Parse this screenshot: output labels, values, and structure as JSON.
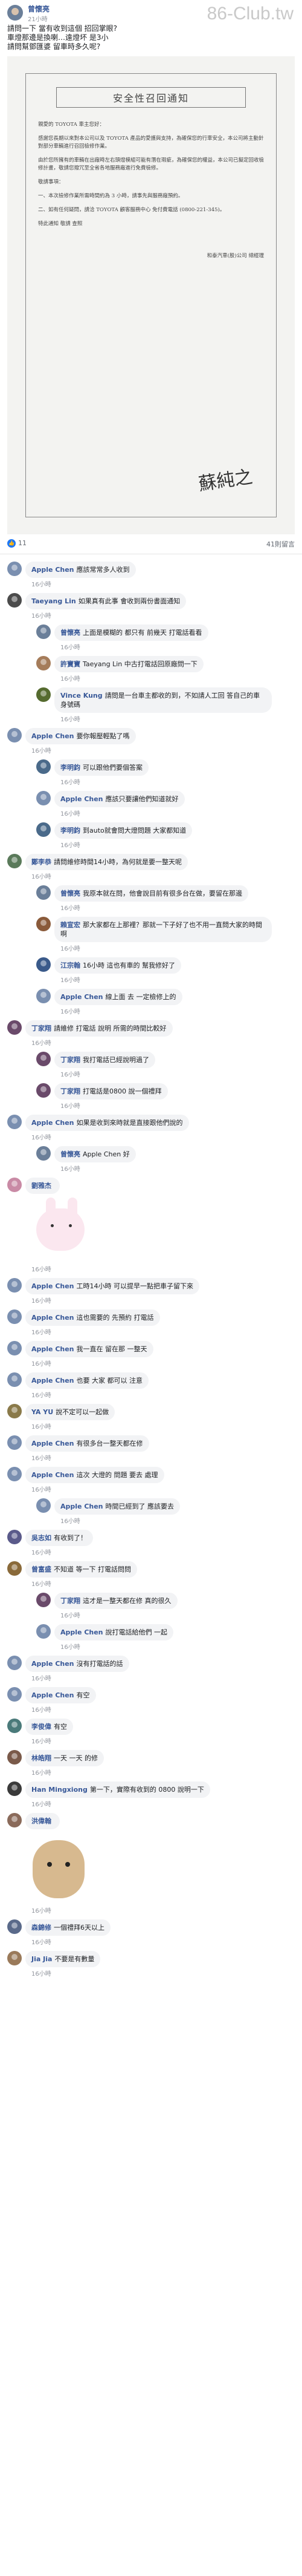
{
  "watermark": "86-Club.tw",
  "post": {
    "author": "曾懷亮",
    "time": "21小時",
    "text": [
      "請問一下 當有收到這個 招回掌眼?",
      "車燈那邊是換喇…遠燈坏 是3小",
      "請問幫鄧匯婆 留車時多久呢?"
    ]
  },
  "letter": {
    "title": "安全性召回通知",
    "p1": "親愛的 TOYOTA 車主您好：",
    "p2": "感謝您長期以來對本公司以及 TOYOTA 產品的愛護與支持，為確保您的行車安全，本公司將主動針對部分車輛進行召回檢修作業。",
    "p3": "由於您所擁有的車輛在出廠時左右頭燈模組可能有潛在瑕疵，為確保您的權益，本公司已擬定回收檢修計畫，敬請您撥冗至全省各地服務廠進行免費檢修。",
    "p4": "敬請事項：",
    "p5": "一、本次檢修作業所需時間約為 3 小時，請事先與服務廠預約。",
    "p6": "二、如有任何疑問，請洽 TOYOTA 顧客服務中心 免付費電話 (0800-221-345)。",
    "p7": "特此通知 敬請 查照",
    "p8": "和泰汽車(股)公司 總經理",
    "signature": "蘇純之"
  },
  "stats": {
    "likes": "11",
    "comments": "41則留言"
  },
  "comments": [
    {
      "n": "Apple Chen",
      "t": "應該常常多人收到",
      "time": "16小時",
      "r": 0,
      "c": "#7a8fb0"
    },
    {
      "n": "Taeyang Lin",
      "t": "如果真有此事 會收到兩份書面通知",
      "time": "16小時",
      "r": 0,
      "c": "#4b4b4b"
    },
    {
      "n": "曾懷亮",
      "t": "上面是模糊的 都只有 前幾天 打電話看看",
      "time": "16小時",
      "r": 1,
      "c": "#6b7f99"
    },
    {
      "n": "許寶寶",
      "t": "Taeyang Lin 中古打電話回原廠問一下",
      "time": "16小時",
      "r": 1,
      "c": "#a57c5a"
    },
    {
      "n": "Vince Kung",
      "t": "請問是一台車主都收的到，不如請人工回 答自己的車身號碼",
      "time": "16小時",
      "r": 1,
      "c": "#556b2f"
    },
    {
      "n": "Apple Chen",
      "t": "要你報壓輕點了嗎",
      "time": "16小時",
      "r": 0,
      "c": "#7a8fb0"
    },
    {
      "n": "李明鈞",
      "t": "可以跟他們要個答案",
      "time": "16小時",
      "r": 1,
      "c": "#4a6a8a"
    },
    {
      "n": "Apple Chen",
      "t": "應該只要讓他們知道就好",
      "time": "16小時",
      "r": 1,
      "c": "#7a8fb0"
    },
    {
      "n": "李明鈞",
      "t": "到auto就會問大燈問題 大家都知道",
      "time": "16小時",
      "r": 1,
      "c": "#4a6a8a"
    },
    {
      "n": "鄭李恭",
      "t": "請問維修時間14小時，為何就是要一整天呢",
      "time": "16小時",
      "r": 0,
      "c": "#5a7a5a"
    },
    {
      "n": "曾懷亮",
      "t": "我原本就在問，他會說目前有很多台在做，要留在那邊",
      "time": "16小時",
      "r": 1,
      "c": "#6b7f99"
    },
    {
      "n": "賴宣宏",
      "t": "那大家都在上那裡？那就一下子好了也不用一直問大家的時間啊",
      "time": "16小時",
      "r": 1,
      "c": "#8a5a3a"
    },
    {
      "n": "江宗翰",
      "t": "16小時 這也有車的 幫我修好了",
      "time": "16小時",
      "r": 1,
      "c": "#3a5a8a"
    },
    {
      "n": "Apple Chen",
      "t": "線上面 去 一定檢修上的",
      "time": "16小時",
      "r": 1,
      "c": "#7a8fb0"
    },
    {
      "n": "丁家翔",
      "t": "請維修 打電話 說明 所需的時間比較好",
      "time": "16小時",
      "r": 0,
      "c": "#6a4a6a"
    },
    {
      "n": "丁家翔",
      "t": "我打電話已經說明過了",
      "time": "16小時",
      "r": 1,
      "c": "#6a4a6a"
    },
    {
      "n": "丁家翔",
      "t": "打電話是0800 說一個禮拜",
      "time": "16小時",
      "r": 1,
      "c": "#6a4a6a"
    },
    {
      "n": "Apple Chen",
      "t": "如果是收到來時就是直接跟他們說的",
      "time": "16小時",
      "r": 0,
      "c": "#7a8fb0"
    },
    {
      "n": "曾懷亮",
      "t": "Apple Chen 好",
      "time": "16小時",
      "r": 1,
      "c": "#6b7f99"
    },
    {
      "n": "劉雅杰",
      "t": "",
      "time": "16小時",
      "r": 0,
      "c": "#c98aa5",
      "sticker": "bunny"
    },
    {
      "n": "Apple Chen",
      "t": "工時14小時 可以提早一點把車子留下來",
      "time": "16小時",
      "r": 0,
      "c": "#7a8fb0"
    },
    {
      "n": "Apple Chen",
      "t": "這也需要的 先預約 打電話",
      "time": "16小時",
      "r": 0,
      "c": "#7a8fb0"
    },
    {
      "n": "Apple Chen",
      "t": "我一直在 留在那 一整天",
      "time": "16小時",
      "r": 0,
      "c": "#7a8fb0"
    },
    {
      "n": "Apple Chen",
      "t": "也要 大家 都可以 注意",
      "time": "16小時",
      "r": 0,
      "c": "#7a8fb0"
    },
    {
      "n": "YA YU",
      "t": "說不定可以一起做",
      "time": "16小時",
      "r": 0,
      "c": "#8a7a4a"
    },
    {
      "n": "Apple Chen",
      "t": "有很多台一整天都在修",
      "time": "16小時",
      "r": 0,
      "c": "#7a8fb0"
    },
    {
      "n": "Apple Chen",
      "t": "這次 大燈的 問題 要去 處理",
      "time": "16小時",
      "r": 0,
      "c": "#7a8fb0"
    },
    {
      "n": "Apple Chen",
      "t": "時間已經到了 應該要去",
      "time": "16小時",
      "r": 1,
      "c": "#7a8fb0"
    },
    {
      "n": "吳志如",
      "t": "有收到了！",
      "time": "16小時",
      "r": 0,
      "c": "#5a5a8a"
    },
    {
      "n": "曾富盛",
      "t": "不知道 等一下 打電話問問",
      "time": "16小時",
      "r": 0,
      "c": "#8a6a3a"
    },
    {
      "n": "丁家翔",
      "t": "這才是一整天都在修 真的很久",
      "time": "16小時",
      "r": 1,
      "c": "#6a4a6a"
    },
    {
      "n": "Apple Chen",
      "t": "說打電話給他們 一起",
      "time": "16小時",
      "r": 1,
      "c": "#7a8fb0"
    },
    {
      "n": "Apple Chen",
      "t": "沒有打電話的話",
      "time": "16小時",
      "r": 0,
      "c": "#7a8fb0"
    },
    {
      "n": "Apple Chen",
      "t": "有空",
      "time": "16小時",
      "r": 0,
      "c": "#7a8fb0"
    },
    {
      "n": "李俊偉",
      "t": "有空",
      "time": "16小時",
      "r": 0,
      "c": "#4a7a7a"
    },
    {
      "n": "林皓翔",
      "t": "一天 一天 的修",
      "time": "16小時",
      "r": 0,
      "c": "#7a5a4a"
    },
    {
      "n": "Han Mingxiong",
      "t": "第一下，實際有收到的 0800 說明一下",
      "time": "16小時",
      "r": 0,
      "c": "#3a3a3a"
    },
    {
      "n": "洪偉翰",
      "t": "",
      "time": "16小時",
      "r": 0,
      "c": "#8a6a5a",
      "sticker": "dog"
    },
    {
      "n": "森錦修",
      "t": "一個禮拜6天以上",
      "time": "16小時",
      "r": 0,
      "c": "#5a6a8a"
    },
    {
      "n": "Jia Jia",
      "t": "不要是有數量",
      "time": "16小時",
      "r": 0,
      "c": "#9a7a5a"
    }
  ]
}
